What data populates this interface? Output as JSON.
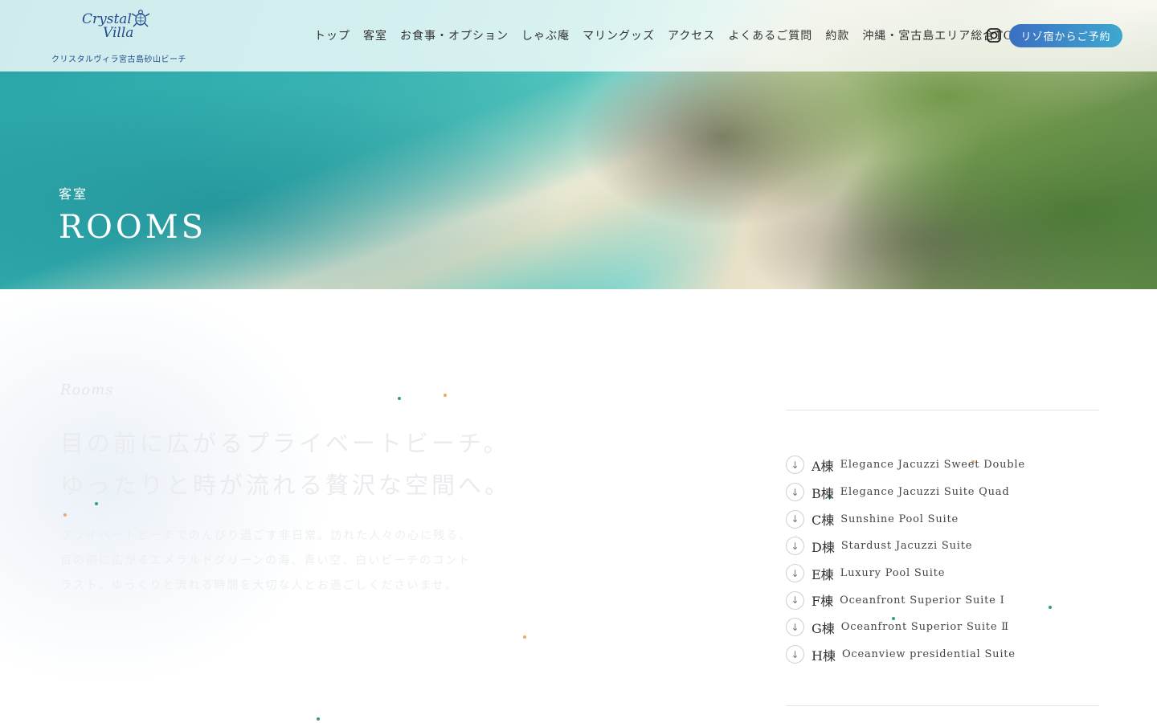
{
  "header": {
    "logo_line1": "Crystal",
    "logo_line2": "Villa",
    "logo_caption": "クリスタルヴィラ宮古島砂山ビーチ",
    "nav": [
      {
        "label": "トップ"
      },
      {
        "label": "客室"
      },
      {
        "label": "お食事・オプション"
      },
      {
        "label": "しゃぶ庵"
      },
      {
        "label": "マリングッズ"
      },
      {
        "label": "アクセス"
      },
      {
        "label": "よくあるご質問"
      },
      {
        "label": "約款"
      },
      {
        "label": "沖縄・宮古島エリア総合TOP"
      }
    ],
    "instagram_icon": "instagram-icon",
    "reserve_label": "リゾ宿からご予約",
    "reserve_colors": [
      "#3b6fc3",
      "#3ea8cf"
    ]
  },
  "hero": {
    "sub": "客室",
    "title": "ROOMS"
  },
  "intro": {
    "script": "Rooms",
    "heading_line1": "目の前に広がるプライベートビーチ。",
    "heading_line2": "ゆったりと時が流れる贅沢な空間へ。",
    "body_line1": "プライベートビーチでのんびり過ごす非日常。訪れた人々の心に残る、",
    "body_line2": "目の前に広がるエメラルドグリーンの海、青い空、白いビーチのコント",
    "body_line3": "ラスト。ゆっくりと流れる時間を大切な人とお過ごしくださいませ。"
  },
  "rooms": [
    {
      "code": "A棟",
      "name": "Elegance Jacuzzi Sweet Double"
    },
    {
      "code": "B棟",
      "name": "Elegance Jacuzzi Suite Quad"
    },
    {
      "code": "C棟",
      "name": "Sunshine Pool Suite"
    },
    {
      "code": "D棟",
      "name": "Stardust Jacuzzi Suite"
    },
    {
      "code": "E棟",
      "name": "Luxury Pool Suite"
    },
    {
      "code": "F棟",
      "name": "Oceanfront Superior Suite Ⅰ"
    },
    {
      "code": "G棟",
      "name": "Oceanfront Superior Suite Ⅱ"
    },
    {
      "code": "H棟",
      "name": "Oceanview presidential Suite"
    }
  ],
  "colors": {
    "brand_blue": "#1e4c8f",
    "dot_teal": "#3a9a8a",
    "dot_orange": "#f0a860"
  }
}
